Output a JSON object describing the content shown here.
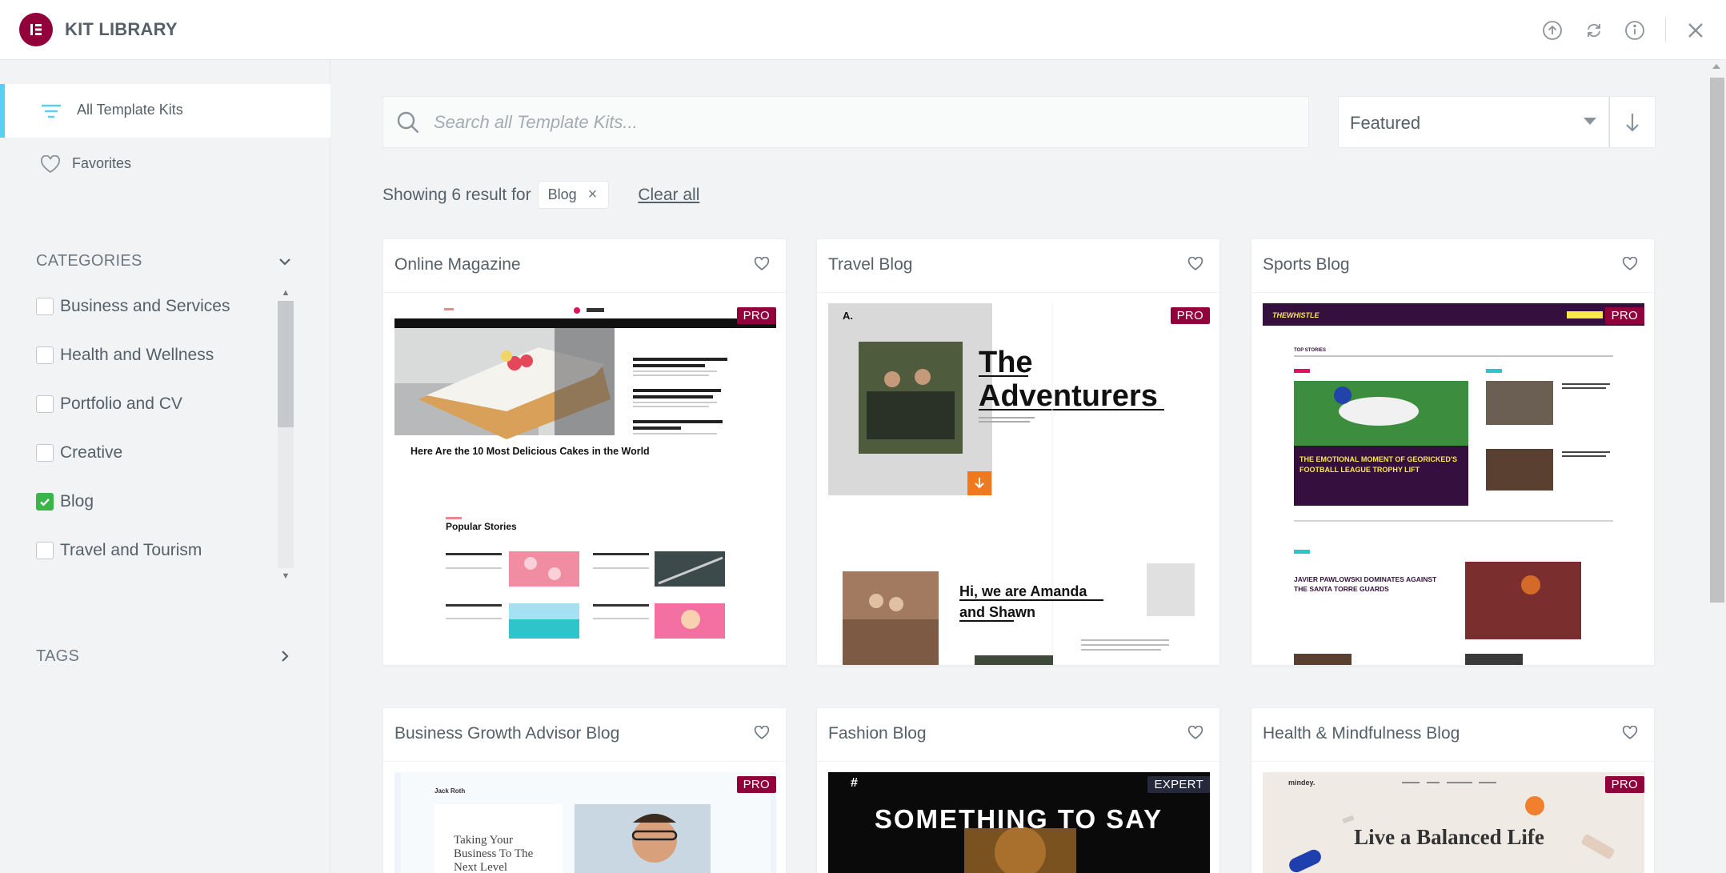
{
  "header": {
    "app_title": "KIT LIBRARY",
    "icons": [
      "upload-icon",
      "sync-icon",
      "info-icon",
      "close-icon"
    ]
  },
  "sidebar": {
    "nav": [
      {
        "label": "All Template Kits",
        "icon": "filter-lines-icon",
        "active": true
      },
      {
        "label": "Favorites",
        "icon": "heart-icon",
        "active": false
      }
    ],
    "categories_title": "CATEGORIES",
    "categories": [
      {
        "label": "Business and Services",
        "checked": false
      },
      {
        "label": "Health and Wellness",
        "checked": false
      },
      {
        "label": "Portfolio and CV",
        "checked": false
      },
      {
        "label": "Creative",
        "checked": false
      },
      {
        "label": "Blog",
        "checked": true
      },
      {
        "label": "Travel and Tourism",
        "checked": false
      }
    ],
    "tags_title": "TAGS"
  },
  "main": {
    "search": {
      "placeholder": "Search all Template Kits...",
      "value": ""
    },
    "sort": {
      "selected": "Featured"
    },
    "results": {
      "prefix": "Showing 6 result for",
      "chip": "Blog",
      "clear_all": "Clear all"
    },
    "cards": [
      {
        "title": "Online Magazine",
        "badge": "PRO",
        "thumb": {
          "headline": "Here Are the 10 Most Delicious Cakes in the World",
          "section": "Popular Stories"
        }
      },
      {
        "title": "Travel Blog",
        "badge": "PRO",
        "thumb": {
          "headline1": "The",
          "headline2": "Adventurers",
          "sub1": "Hi, we are Amanda",
          "sub2": "and Shawn",
          "letter": "A."
        }
      },
      {
        "title": "Sports Blog",
        "badge": "PRO",
        "thumb": {
          "brand": "THEWHISTLE",
          "section": "TOP STORIES",
          "headline": "THE EMOTIONAL MOMENT OF GEORICKED'S FOOTBALL LEAGUE TROPHY LIFT",
          "headline2": "JAVIER PAWLOWSKI DOMINATES AGAINST THE SANTA TORRE GUARDS"
        }
      },
      {
        "title": "Business Growth Advisor Blog",
        "badge": "PRO",
        "thumb": {
          "name": "Jack Roth",
          "headline": "Taking Your Business To The Next Level"
        }
      },
      {
        "title": "Fashion Blog",
        "badge": "EXPERT",
        "thumb": {
          "mark": "#",
          "headline": "SOMETHING TO SAY"
        }
      },
      {
        "title": "Health & Mindfulness Blog",
        "badge": "PRO",
        "thumb": {
          "brand": "mindey.",
          "headline": "Live a Balanced Life"
        }
      }
    ]
  },
  "colors": {
    "brand": "#92003b",
    "accent": "#58d0f5",
    "check": "#39b54a",
    "expert": "#26283b"
  }
}
